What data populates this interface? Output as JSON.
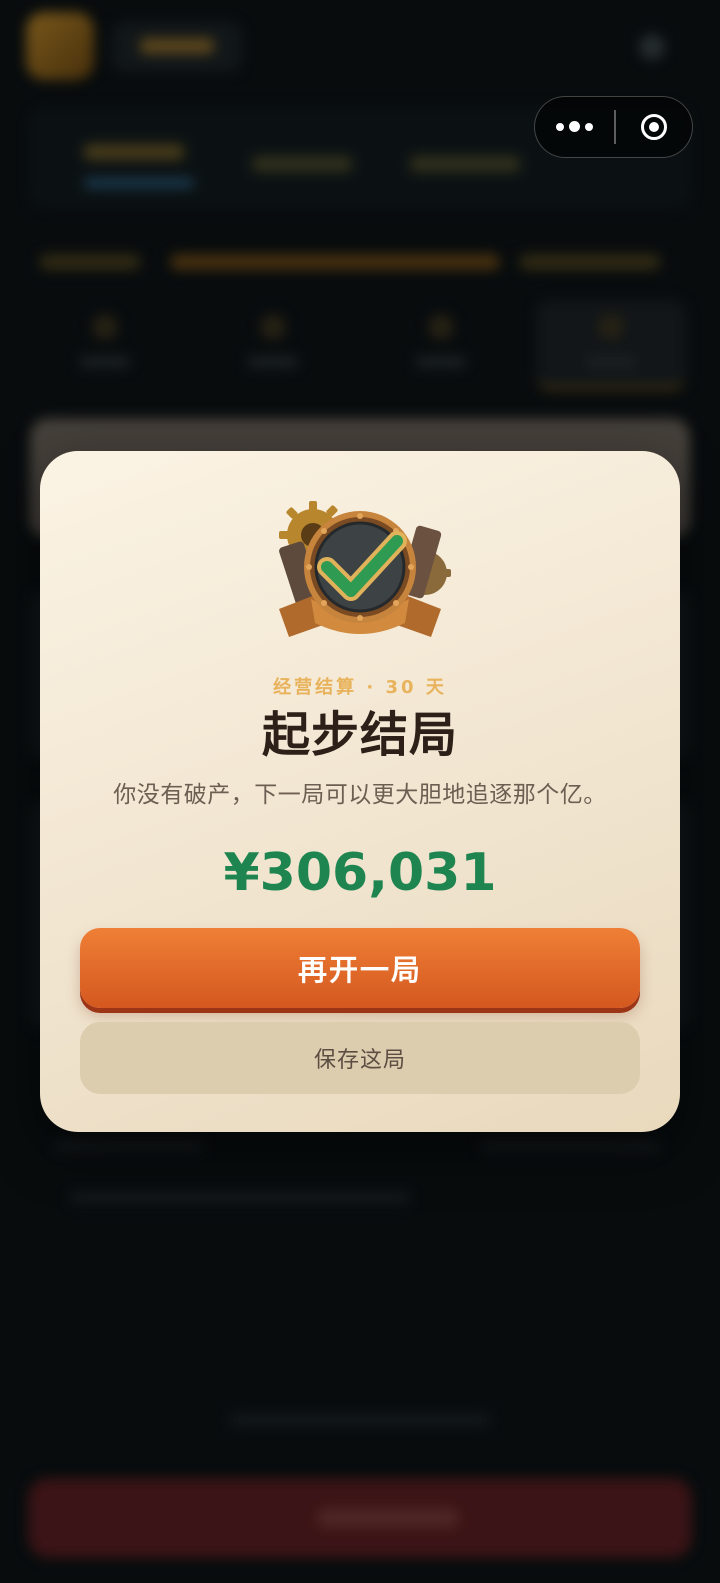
{
  "capsule": {
    "more_icon": "more-dots-icon",
    "close_icon": "close-target-icon"
  },
  "modal": {
    "badge_icon": "gear-checkmark-badge-icon",
    "subtitle": "经营结算 · 30 天",
    "title": "起步结局",
    "description": "你没有破产，下一局可以更大胆地追逐那个亿。",
    "amount": "¥306,031",
    "primary_button": "再开一局",
    "secondary_button": "保存这局"
  },
  "colors": {
    "amount": "#1e8550",
    "primary_button": "#e4692a",
    "subtitle": "#e8b35c",
    "title": "#2c2018"
  }
}
